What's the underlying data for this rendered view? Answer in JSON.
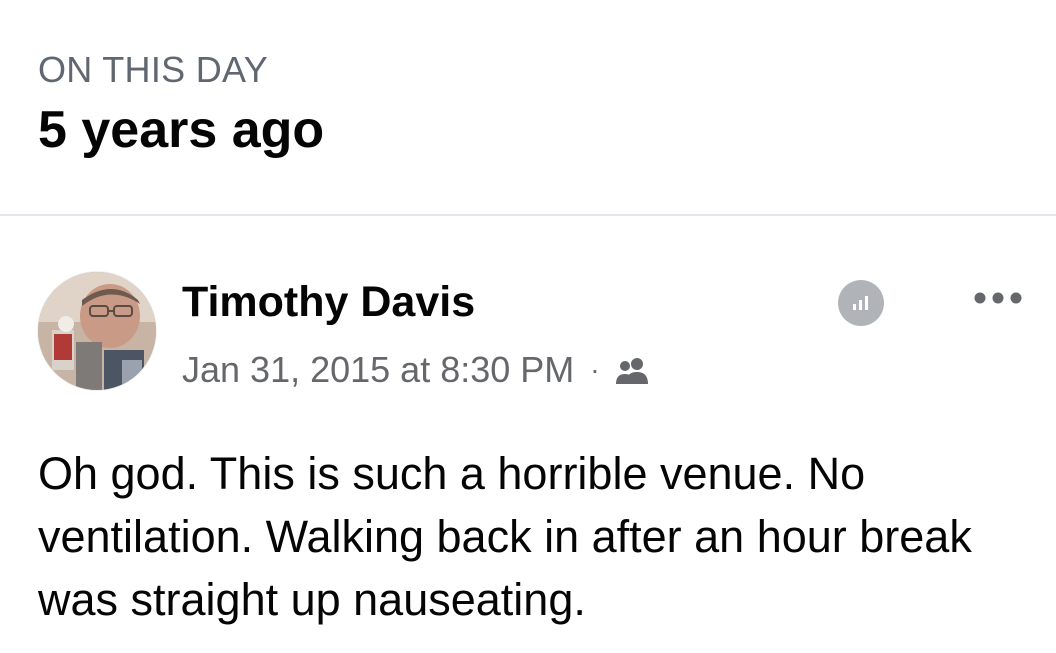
{
  "memory": {
    "overline": "ON THIS DAY",
    "headline": "5 years ago"
  },
  "post": {
    "author": "Timothy Davis",
    "timestamp": "Jan 31, 2015 at 8:30 PM",
    "separator": "·",
    "audience_icon": "friends-icon",
    "insights_icon": "insights-icon",
    "more_icon": "more-options-icon",
    "text": "Oh god. This is such a horrible venue. No ventilation. Walking back in after an hour break was straight up nauseating."
  },
  "colors": {
    "primary_text": "#050505",
    "secondary_text": "#65676b",
    "overline_text": "#606770",
    "divider": "#e4e6eb",
    "icon_gray": "#b0b3b8"
  }
}
